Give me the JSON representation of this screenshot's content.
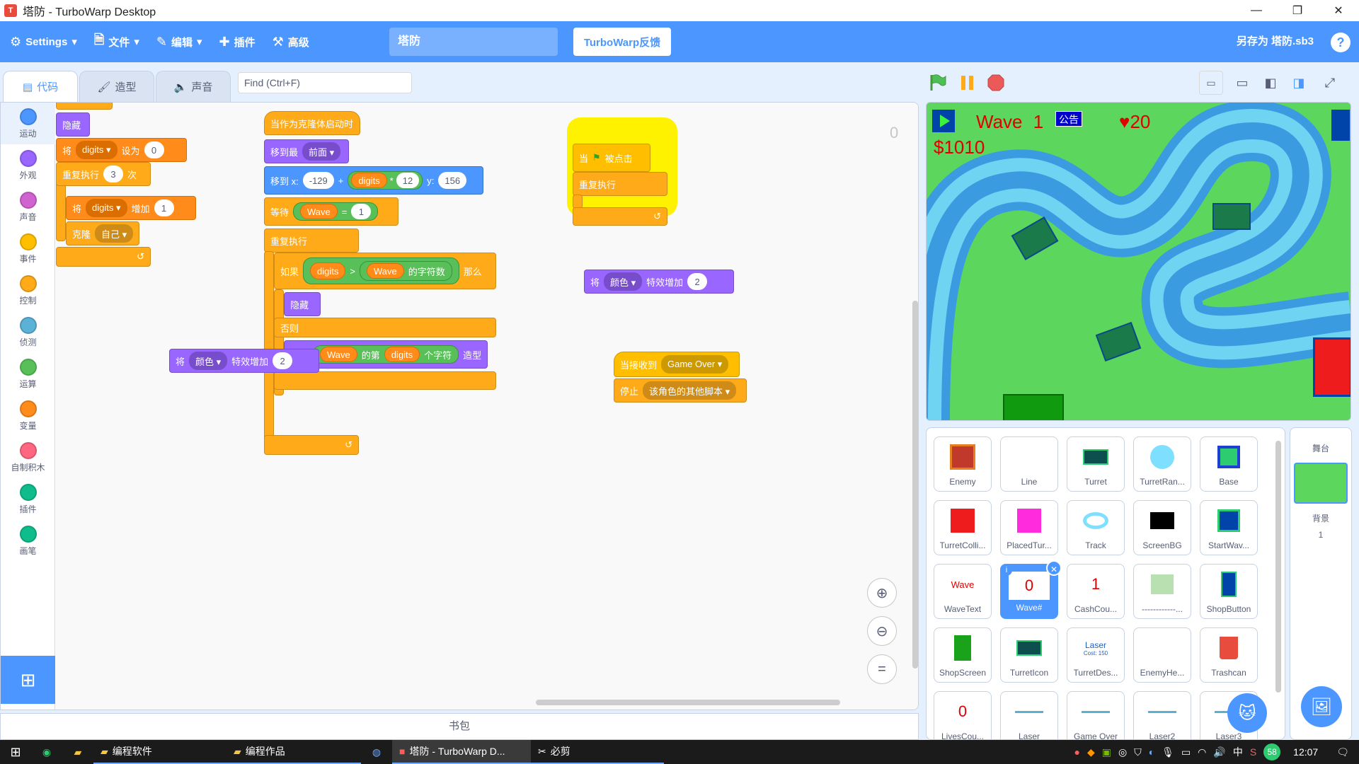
{
  "window": {
    "title": "塔防 - TurboWarp Desktop",
    "minimize": "—",
    "restore": "❐",
    "close": "✕"
  },
  "menu": {
    "settings": "Settings",
    "file": "文件",
    "edit": "编辑",
    "addons": "插件",
    "advanced": "高级",
    "project_title": "塔防",
    "feedback": "TurboWarp反馈",
    "save_as": "另存为 塔防.sb3",
    "help": "?"
  },
  "tabs": {
    "code": "代码",
    "costumes": "造型",
    "sounds": "声音"
  },
  "find": {
    "placeholder": "Find (Ctrl+F)"
  },
  "categories": [
    {
      "label": "运动",
      "color": "#4c97ff"
    },
    {
      "label": "外观",
      "color": "#9966ff"
    },
    {
      "label": "声音",
      "color": "#cf63cf"
    },
    {
      "label": "事件",
      "color": "#ffbf00"
    },
    {
      "label": "控制",
      "color": "#ffab19"
    },
    {
      "label": "侦测",
      "color": "#5cb1d6"
    },
    {
      "label": "运算",
      "color": "#59c059"
    },
    {
      "label": "变量",
      "color": "#ff8c1a"
    },
    {
      "label": "自制积木",
      "color": "#ff6680"
    },
    {
      "label": "插件",
      "color": "#0fbd8c"
    },
    {
      "label": "画笔",
      "color": "#0fbd8c"
    }
  ],
  "script1": {
    "hide": "隐藏",
    "set_kw": "将",
    "set_var": "digits ▾",
    "set_to": "设为",
    "set_val": "0",
    "repeat_kw": "重复执行",
    "repeat_n": "3",
    "repeat_times": "次",
    "change_kw": "将",
    "change_var": "digits ▾",
    "change_by": "增加",
    "change_val": "1",
    "clone_kw": "克隆",
    "clone_target": "自己 ▾",
    "arrow": "↺"
  },
  "script2": {
    "hat": "当作为克隆体启动时",
    "goto_front": "移到最",
    "front_opt": "前面 ▾",
    "goto_x": "移到 x:",
    "x_val": "-129",
    "plus": "+",
    "digits": "digits",
    "times": "*",
    "mult": "12",
    "y_lbl": "y:",
    "y_val": "156",
    "wait": "等待",
    "wave": "Wave",
    "eq": "=",
    "eq_val": "1",
    "forever": "重复执行",
    "if_kw": "如果",
    "gt": ">",
    "len_of": "的字符数",
    "then": "那么",
    "hide": "隐藏",
    "else": "否则",
    "switch": "换成",
    "letter_of": "的第",
    "letter": "个字符",
    "costume": "造型",
    "arrow": "↺"
  },
  "floating1": {
    "change_kw": "将",
    "effect": "颜色 ▾",
    "by": "特效增加",
    "val": "2"
  },
  "script3": {
    "when": "当",
    "flag": "⚑",
    "clicked": "被点击",
    "forever": "重复执行",
    "arrow": "↺"
  },
  "floating2": {
    "change_kw": "将",
    "effect": "颜色 ▾",
    "by": "特效增加",
    "val": "2"
  },
  "script4": {
    "hat": "当接收到",
    "msg": "Game Over ▾",
    "stop": "停止",
    "stop_opt": "该角色的其他脚本 ▾"
  },
  "workspace": {
    "counter": "0",
    "zoom_in": "⊕",
    "zoom_out": "⊖",
    "zoom_reset": "="
  },
  "backpack": "书包",
  "stage_hud": {
    "wave_label": "Wave",
    "wave_num": "1",
    "announce": "公告",
    "lives": "20",
    "cash": "$1010"
  },
  "sprites": [
    {
      "name": "Enemy",
      "thumb": "enemy"
    },
    {
      "name": "Line",
      "thumb": "none"
    },
    {
      "name": "Turret",
      "thumb": "turret"
    },
    {
      "name": "TurretRan...",
      "thumb": "cyan-circle"
    },
    {
      "name": "Base",
      "thumb": "base"
    },
    {
      "name": "TurretColli...",
      "thumb": "red-square"
    },
    {
      "name": "PlacedTur...",
      "thumb": "magenta-square"
    },
    {
      "name": "Track",
      "thumb": "track"
    },
    {
      "name": "ScreenBG",
      "thumb": "black-square"
    },
    {
      "name": "StartWav...",
      "thumb": "start-wave"
    },
    {
      "name": "WaveText",
      "thumb": "text",
      "thumb_text": "Wave"
    },
    {
      "name": "Wave#",
      "thumb": "text",
      "thumb_text": "0",
      "selected": true
    },
    {
      "name": "CashCou...",
      "thumb": "text",
      "thumb_text": "1"
    },
    {
      "name": "------------...",
      "thumb": "tank-pic"
    },
    {
      "name": "ShopButton",
      "thumb": "shop-button"
    },
    {
      "name": "ShopScreen",
      "thumb": "green-rect"
    },
    {
      "name": "TurretIcon",
      "thumb": "turret"
    },
    {
      "name": "TurretDes...",
      "thumb": "laser-text",
      "thumb_text": "Laser",
      "thumb_sub": "Cost: 150"
    },
    {
      "name": "EnemyHe...",
      "thumb": "none"
    },
    {
      "name": "Trashcan",
      "thumb": "trash"
    },
    {
      "name": "LivesCou...",
      "thumb": "text",
      "thumb_text": "0"
    },
    {
      "name": "Laser",
      "thumb": "line"
    },
    {
      "name": "Game Over",
      "thumb": "line"
    },
    {
      "name": "Laser2",
      "thumb": "line"
    },
    {
      "name": "Laser3",
      "thumb": "line"
    }
  ],
  "stage_pane": {
    "title": "舞台",
    "backdrops_label": "背景",
    "backdrops_count": "1"
  },
  "taskbar": {
    "items": [
      {
        "label": "编程软件"
      },
      {
        "label": "编程作品"
      },
      {
        "label": "塔防 - TurboWarp D..."
      },
      {
        "label": "必剪"
      }
    ],
    "ime": "中",
    "badge": "58",
    "time": "12:07"
  }
}
